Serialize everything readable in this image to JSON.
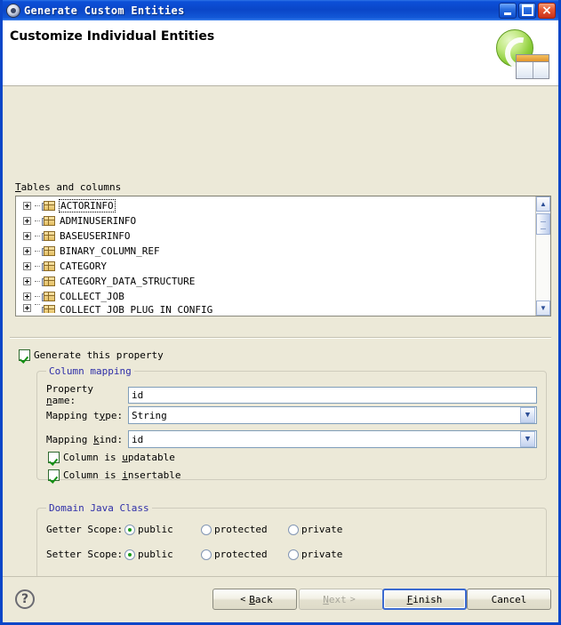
{
  "window": {
    "title": "Generate Custom Entities",
    "icon": "app-gear-icon",
    "minimize_label": "Minimize",
    "maximize_label": "Maximize",
    "close_label": "×"
  },
  "banner": {
    "title": "Customize Individual Entities",
    "icon": "entities-table-icon"
  },
  "tree": {
    "label": "Tables and columns",
    "label_mnemonic": "T",
    "items": [
      {
        "name": "ACTORINFO",
        "selected": true,
        "expandable": true
      },
      {
        "name": "ADMINUSERINFO",
        "selected": false,
        "expandable": true
      },
      {
        "name": "BASEUSERINFO",
        "selected": false,
        "expandable": true
      },
      {
        "name": "BINARY_COLUMN_REF",
        "selected": false,
        "expandable": true
      },
      {
        "name": "CATEGORY",
        "selected": false,
        "expandable": true
      },
      {
        "name": "CATEGORY_DATA_STRUCTURE",
        "selected": false,
        "expandable": true
      },
      {
        "name": "COLLECT_JOB",
        "selected": false,
        "expandable": true
      },
      {
        "name": "COLLECT_JOB_PLUG_IN_CONFIG",
        "selected": false,
        "expandable": true
      }
    ],
    "scrollbar": {
      "up_arrow": "▲",
      "down_arrow": "▼"
    }
  },
  "generate_property": {
    "label": "Generate this property",
    "checked": true
  },
  "column_mapping": {
    "title": "Column mapping",
    "property_name": {
      "label_pre": "Property ",
      "label_mnemonic": "n",
      "label_post": "ame:",
      "value": "id"
    },
    "mapping_type": {
      "label_pre": "Mapping t",
      "label_mnemonic": "y",
      "label_post": "pe:",
      "value": "String",
      "arrow": "▼"
    },
    "mapping_kind": {
      "label_pre": "Mapping ",
      "label_mnemonic": "k",
      "label_post": "ind:",
      "value": "id",
      "arrow": "▼"
    },
    "updatable": {
      "label_pre": "Column is ",
      "label_mnemonic": "u",
      "label_post": "pdatable",
      "checked": true
    },
    "insertable": {
      "label_pre": "Column is ",
      "label_mnemonic": "i",
      "label_post": "nsertable",
      "checked": true
    }
  },
  "domain_java_class": {
    "title": "Domain Java Class",
    "getter": {
      "label": "Getter Scope:",
      "options": [
        "public",
        "protected",
        "private"
      ],
      "selected": "public"
    },
    "setter": {
      "label": "Setter Scope:",
      "options": [
        "public",
        "protected",
        "private"
      ],
      "selected": "public"
    }
  },
  "buttons": {
    "help": "?",
    "back": {
      "label": "Back",
      "mnemonic": "B",
      "prefix": "<",
      "enabled": true
    },
    "next": {
      "label": "Next",
      "mnemonic": "N",
      "suffix": ">",
      "enabled": false
    },
    "finish": {
      "label": "Finish",
      "mnemonic": "F",
      "enabled": true,
      "default": true
    },
    "cancel": {
      "label": "Cancel",
      "mnemonic": "C",
      "enabled": true
    }
  },
  "colors": {
    "titlebar": "#0a46c8",
    "dialog_bg": "#ece9d8",
    "group_title": "#2e2ea8",
    "field_border": "#7f9db9",
    "accent_green": "#8ece3c"
  }
}
